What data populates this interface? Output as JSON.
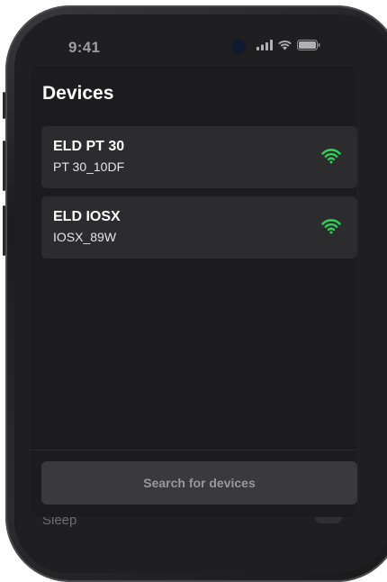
{
  "status_bar": {
    "time": "9:41"
  },
  "background_app": {
    "sleep_label": "Sleep"
  },
  "sheet": {
    "title": "Devices",
    "devices": [
      {
        "name": "ELD PT 30",
        "id": "PT 30_10DF",
        "signal_icon": "wifi-signal-icon",
        "signal_color": "#30d158"
      },
      {
        "name": "ELD IOSX",
        "id": "IOSX_89W",
        "signal_icon": "wifi-signal-icon",
        "signal_color": "#30d158"
      }
    ],
    "search_button_label": "Search for devices"
  },
  "colors": {
    "sheet_background": "#1c1c1e",
    "card_background": "#2c2c2e",
    "button_background": "#3a3a3c",
    "signal_green": "#30d158"
  }
}
